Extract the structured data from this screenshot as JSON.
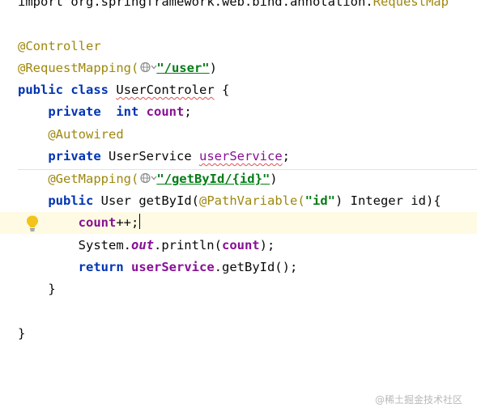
{
  "editor": {
    "line_import": {
      "kw": "import",
      "pkg": "org.springframework.web.bind.annotation.",
      "cls": "RequestMap"
    },
    "line_controller": "@Controller",
    "line_request_mapping": {
      "annotation": "@RequestMapping(",
      "string": "\"/user\"",
      "close": ")"
    },
    "line_class": {
      "kw1": "public",
      "kw2": "class",
      "name": "UserControler",
      "brace": "{"
    },
    "line_count_field": {
      "kw1": "private",
      "kw2": "int",
      "field": "count",
      "semi": ";"
    },
    "line_autowired": "@Autowired",
    "line_service_field": {
      "kw": "private",
      "type": "UserService",
      "field": "userService",
      "semi": ";"
    },
    "line_get_mapping": {
      "annotation": "@GetMapping(",
      "string": "\"/getById/{id}\"",
      "close": ")"
    },
    "line_method": {
      "kw": "public",
      "sig": "User getById(",
      "annotation": "@PathVariable(",
      "string": "\"id\"",
      "rest": ") Integer id){"
    },
    "line_increment": {
      "field": "count",
      "op": "++;"
    },
    "line_println": {
      "prefix": "System.",
      "out": "out",
      "call": ".println(",
      "arg": "count",
      "end": ");"
    },
    "line_return": {
      "kw": "return",
      "field": "userService",
      "call": ".getById();"
    },
    "line_close_method": "}",
    "line_close_class": "}"
  },
  "icons": {
    "globe": "globe-icon",
    "chevron": "chevron-down-icon",
    "bulb": "lightbulb-icon"
  },
  "colors": {
    "keyword": "#0033b3",
    "annotation": "#9e880d",
    "field": "#871094",
    "string": "#067d17",
    "current_line": "#fffae3",
    "bulb": "#f2c31a"
  },
  "watermark": "@稀土掘金技术社区"
}
